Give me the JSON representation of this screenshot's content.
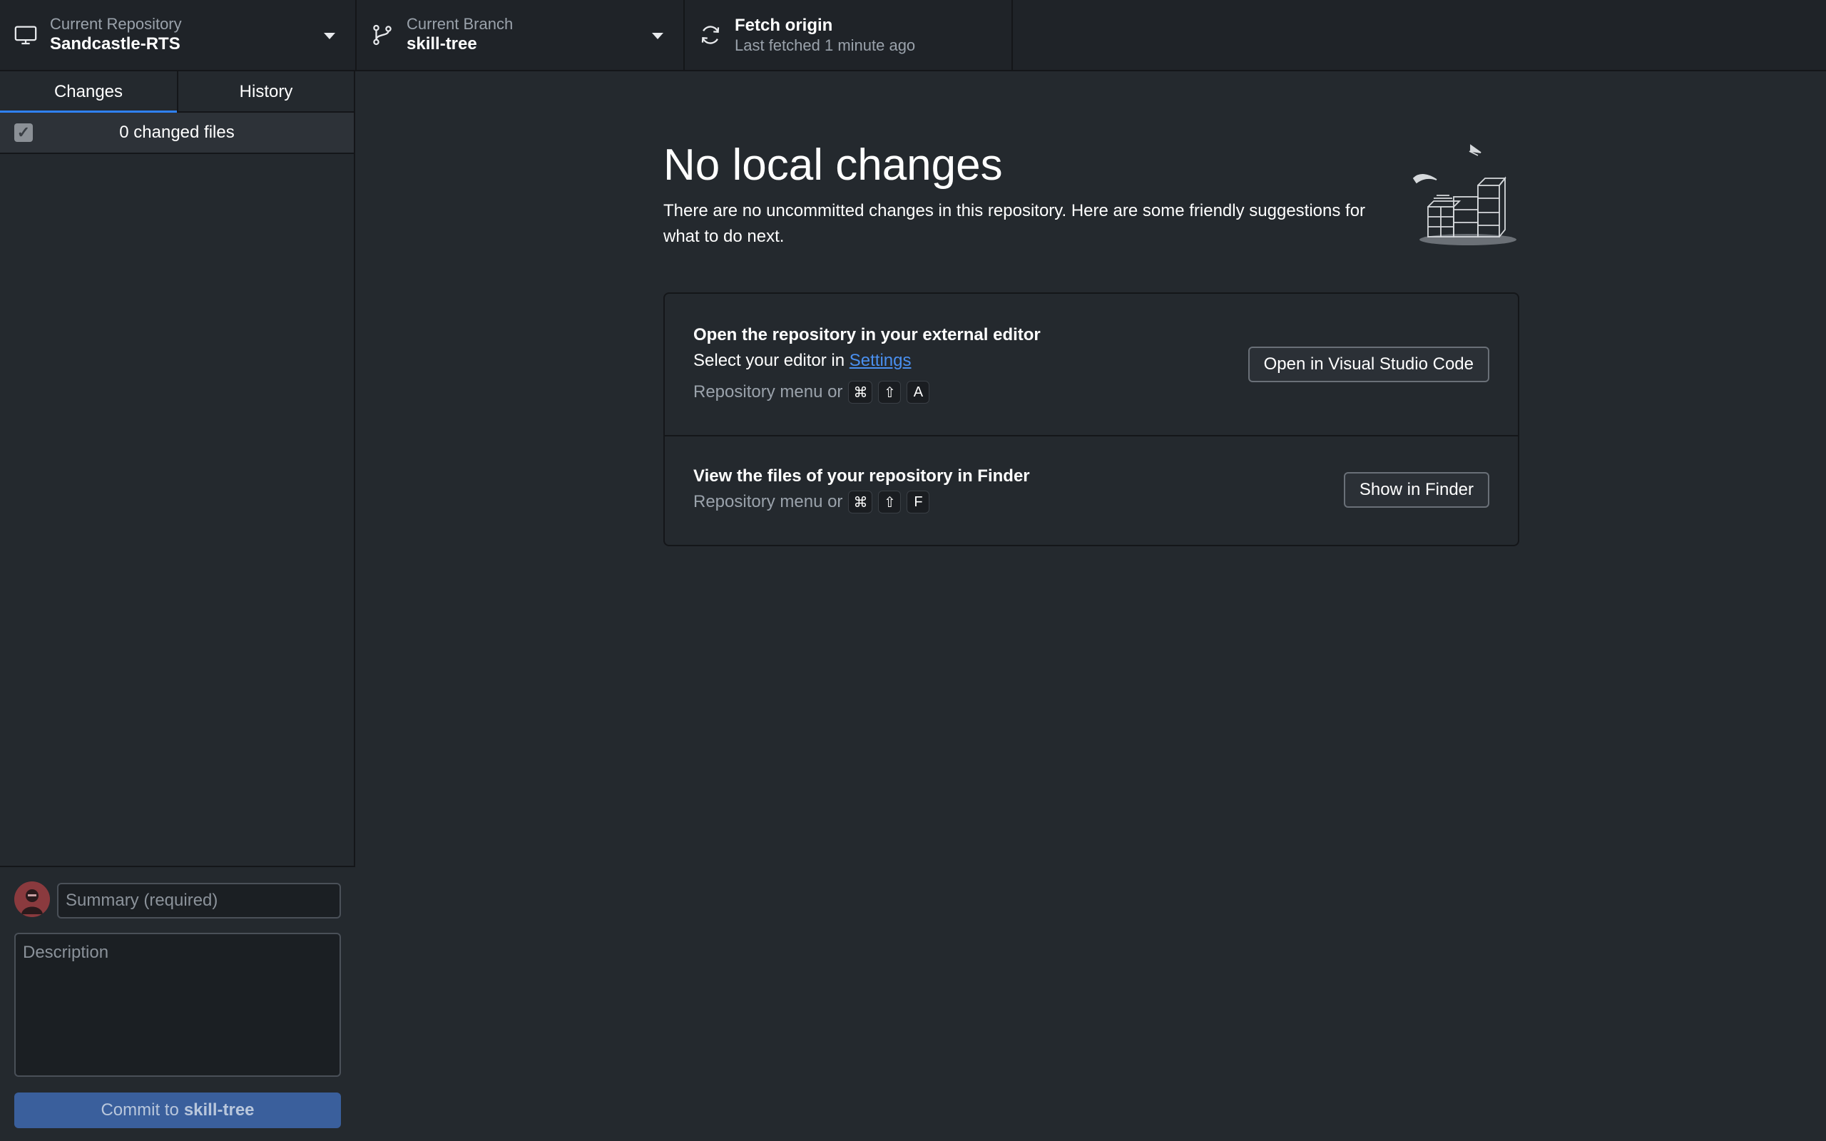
{
  "toolbar": {
    "repo": {
      "label": "Current Repository",
      "value": "Sandcastle-RTS",
      "icon": "desktop-icon"
    },
    "branch": {
      "label": "Current Branch",
      "value": "skill-tree",
      "icon": "git-branch-icon"
    },
    "fetch": {
      "title": "Fetch origin",
      "subtitle": "Last fetched 1 minute ago",
      "icon": "sync-icon"
    }
  },
  "sidebar": {
    "tabs": [
      {
        "label": "Changes",
        "active": true
      },
      {
        "label": "History",
        "active": false
      }
    ],
    "changed_files_label": "0 changed files",
    "select_all_checked": true
  },
  "commit": {
    "summary_placeholder": "Summary (required)",
    "description_placeholder": "Description",
    "button_prefix": "Commit to",
    "button_branch": "skill-tree"
  },
  "main": {
    "heading": "No local changes",
    "intro": "There are no uncommitted changes in this repository. Here are some friendly suggestions for what to do next.",
    "suggestions": [
      {
        "title": "Open the repository in your external editor",
        "text_prefix": "Select your editor in",
        "link": "Settings",
        "shortcut_prefix": "Repository menu or",
        "keys": [
          "⌘",
          "⇧",
          "A"
        ],
        "button": "Open in Visual Studio Code"
      },
      {
        "title": "View the files of your repository in Finder",
        "shortcut_prefix": "Repository menu or",
        "keys": [
          "⌘",
          "⇧",
          "F"
        ],
        "button": "Show in Finder"
      }
    ]
  },
  "colors": {
    "background": "#24292e",
    "toolbar": "#1f2328",
    "accent": "#2f81f7",
    "commit_button": "#3a5f9c",
    "link": "#4a90f0"
  }
}
